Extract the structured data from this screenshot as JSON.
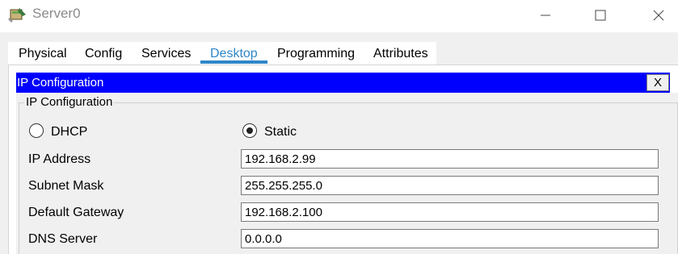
{
  "window": {
    "title": "Server0",
    "minimize_glyph": "—",
    "close_glyph": "✕"
  },
  "tabs": [
    {
      "label": "Physical",
      "active": false
    },
    {
      "label": "Config",
      "active": false
    },
    {
      "label": "Services",
      "active": false
    },
    {
      "label": "Desktop",
      "active": true
    },
    {
      "label": "Programming",
      "active": false
    },
    {
      "label": "Attributes",
      "active": false
    }
  ],
  "ip_config": {
    "header_title": "IP Configuration",
    "close_label": "X",
    "group_label": "IP Configuration",
    "mode": {
      "dhcp_label": "DHCP",
      "static_label": "Static",
      "selected": "Static"
    },
    "fields": {
      "ip_address": {
        "label": "IP Address",
        "value": "192.168.2.99"
      },
      "subnet_mask": {
        "label": "Subnet Mask",
        "value": "255.255.255.0"
      },
      "default_gateway": {
        "label": "Default Gateway",
        "value": "192.168.2.100"
      },
      "dns_server": {
        "label": "DNS Server",
        "value": "0.0.0.0"
      }
    }
  },
  "colors": {
    "accent_tab": "#2f86c8",
    "header_blue": "#0000ff"
  },
  "icons": {
    "app": "server-app-icon",
    "minimize": "minimize-icon",
    "maximize": "maximize-icon",
    "close": "close-icon"
  }
}
